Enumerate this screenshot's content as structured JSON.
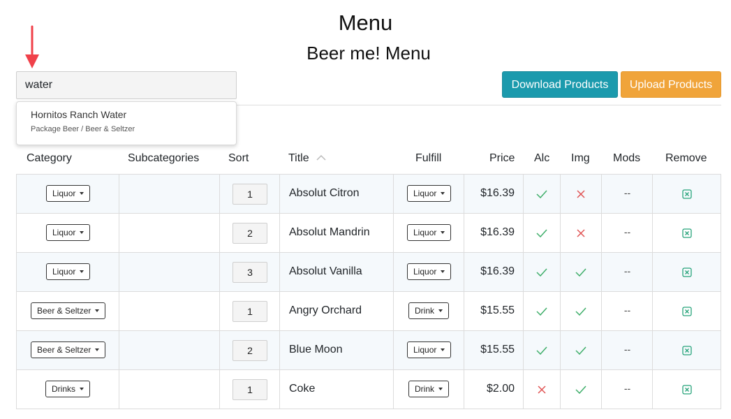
{
  "page_title": "Menu",
  "menu_title": "Beer me! Menu",
  "search": {
    "value": "water"
  },
  "buttons": {
    "download": "Download Products",
    "upload": "Upload Products"
  },
  "autocomplete": {
    "title": "Hornitos Ranch Water",
    "subtitle": "Package Beer / Beer & Seltzer"
  },
  "columns": {
    "category": "Category",
    "subcategories": "Subcategories",
    "sort": "Sort",
    "title": "Title",
    "fulfill": "Fulfill",
    "price": "Price",
    "alc": "Alc",
    "img": "Img",
    "mods": "Mods",
    "remove": "Remove"
  },
  "rows": [
    {
      "category": "Liquor",
      "subcategories": "",
      "sort": "1",
      "title": "Absolut Citron",
      "fulfill": "Liquor",
      "price": "$16.39",
      "alc": true,
      "img": false,
      "mods": "--"
    },
    {
      "category": "Liquor",
      "subcategories": "",
      "sort": "2",
      "title": "Absolut Mandrin",
      "fulfill": "Liquor",
      "price": "$16.39",
      "alc": true,
      "img": false,
      "mods": "--"
    },
    {
      "category": "Liquor",
      "subcategories": "",
      "sort": "3",
      "title": "Absolut Vanilla",
      "fulfill": "Liquor",
      "price": "$16.39",
      "alc": true,
      "img": true,
      "mods": "--"
    },
    {
      "category": "Beer & Seltzer",
      "subcategories": "",
      "sort": "1",
      "title": "Angry Orchard",
      "fulfill": "Drink",
      "price": "$15.55",
      "alc": true,
      "img": true,
      "mods": "--"
    },
    {
      "category": "Beer & Seltzer",
      "subcategories": "",
      "sort": "2",
      "title": "Blue Moon",
      "fulfill": "Liquor",
      "price": "$15.55",
      "alc": true,
      "img": true,
      "mods": "--"
    },
    {
      "category": "Drinks",
      "subcategories": "",
      "sort": "1",
      "title": "Coke",
      "fulfill": "Drink",
      "price": "$2.00",
      "alc": false,
      "img": true,
      "mods": "--"
    }
  ],
  "colors": {
    "download_button": "#1b9aad",
    "upload_button": "#f0a43a",
    "check": "#3fae6a",
    "cross": "#e05353",
    "remove_icon": "#26a37a",
    "arrow": "#f0414a"
  },
  "icons": {
    "yes": "check-icon",
    "no": "cross-icon",
    "remove": "remove-square-icon",
    "sort": "chevron-up-icon",
    "pointer": "red-arrow-icon"
  }
}
